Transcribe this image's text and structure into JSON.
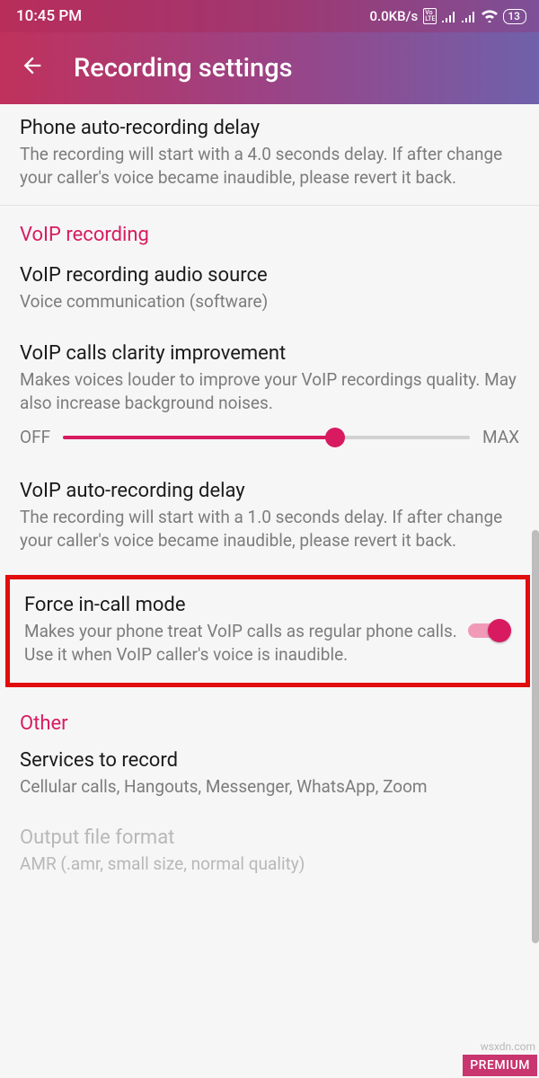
{
  "statusbar": {
    "time": "10:45 PM",
    "speed": "0.0KB/s",
    "volte": "Vo LTE",
    "battery": "13"
  },
  "appbar": {
    "title": "Recording settings"
  },
  "autoDelay": {
    "title": "Phone auto-recording delay",
    "sub": "The recording will start with a 4.0 seconds delay. If after change your caller's voice became inaudible, please revert it back."
  },
  "voipHeader": "VoIP recording",
  "voipSource": {
    "title": "VoIP recording audio source",
    "sub": "Voice communication (software)"
  },
  "voipClarity": {
    "title": "VoIP calls clarity improvement",
    "sub": "Makes voices louder to improve your VoIP recordings quality. May also increase background noises.",
    "off": "OFF",
    "max": "MAX"
  },
  "voipDelay": {
    "title": "VoIP auto-recording delay",
    "sub": "The recording will start with a 1.0 seconds delay. If after change your caller's voice became inaudible, please revert it back."
  },
  "forceInCall": {
    "title": "Force in-call mode",
    "sub": "Makes your phone treat VoIP calls as regular phone calls. Use it when VoIP caller's voice is inaudible."
  },
  "otherHeader": "Other",
  "services": {
    "title": "Services to record",
    "sub": "Cellular calls, Hangouts, Messenger, WhatsApp, Zoom"
  },
  "outputFormat": {
    "title": "Output file format",
    "sub": "AMR (.amr, small size, normal quality)"
  },
  "premium": "PREMIUM",
  "watermark": "wsxdn.com"
}
